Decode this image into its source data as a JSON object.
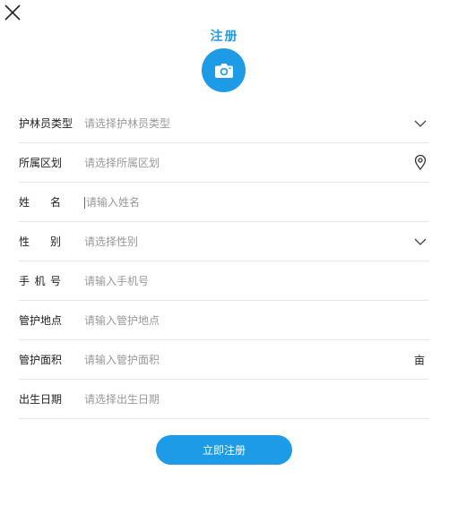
{
  "header": {
    "title": "注册",
    "close_icon": "close-icon",
    "avatar_icon": "camera-icon",
    "accent_color": "#1e9be6"
  },
  "form": {
    "ranger_type": {
      "label": "护林员类型",
      "placeholder": "请选择护林员类型",
      "icon": "chevron-down-icon"
    },
    "region": {
      "label": "所属区划",
      "placeholder": "请选择所属区划",
      "icon": "location-pin-icon"
    },
    "name": {
      "label_chars": [
        "姓",
        "名"
      ],
      "placeholder": "请输入姓名"
    },
    "gender": {
      "label_chars": [
        "性",
        "别"
      ],
      "placeholder": "请选择性别",
      "icon": "chevron-down-icon"
    },
    "phone": {
      "label_chars": [
        "手",
        "机",
        "号"
      ],
      "placeholder": "请输入手机号"
    },
    "location": {
      "label": "管护地点",
      "placeholder": "请输入管护地点"
    },
    "area": {
      "label": "管护面积",
      "placeholder": "请输入管护面积",
      "unit": "亩"
    },
    "birth": {
      "label": "出生日期",
      "placeholder": "请选择出生日期"
    }
  },
  "submit_label": "立即注册"
}
